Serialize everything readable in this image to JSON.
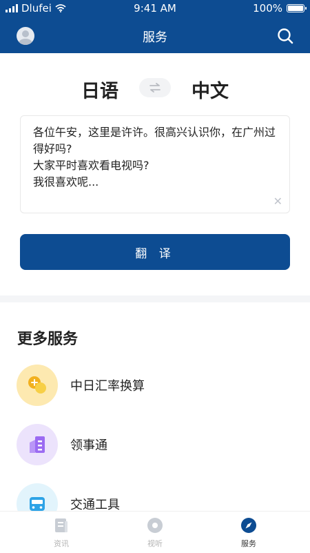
{
  "status_bar": {
    "carrier": "Dlufei",
    "time": "9:41 AM",
    "battery": "100%"
  },
  "header": {
    "title": "服务"
  },
  "translator": {
    "source_lang": "日语",
    "target_lang": "中文",
    "input_text": "各位午安，这里是许许。很高兴认识你，在广州过得好吗?\n大家平时喜欢看电视吗?\n我很喜欢呢...",
    "translate_label": "翻 译"
  },
  "more_services": {
    "title": "更多服务",
    "items": [
      {
        "label": "中日汇率换算",
        "icon": "currency-exchange-icon",
        "color": "#fde9b0"
      },
      {
        "label": "领事通",
        "icon": "consulate-building-icon",
        "color": "#ece3fc"
      },
      {
        "label": "交通工具",
        "icon": "bus-icon",
        "color": "#e2f4fc"
      }
    ]
  },
  "tabbar": {
    "items": [
      {
        "label": "资讯",
        "icon": "news-icon",
        "active": false
      },
      {
        "label": "视听",
        "icon": "media-icon",
        "active": false
      },
      {
        "label": "服务",
        "icon": "compass-icon",
        "active": true
      }
    ]
  },
  "colors": {
    "brand": "#0d4c92",
    "background": "#ffffff",
    "divider": "#f4f5f7"
  }
}
